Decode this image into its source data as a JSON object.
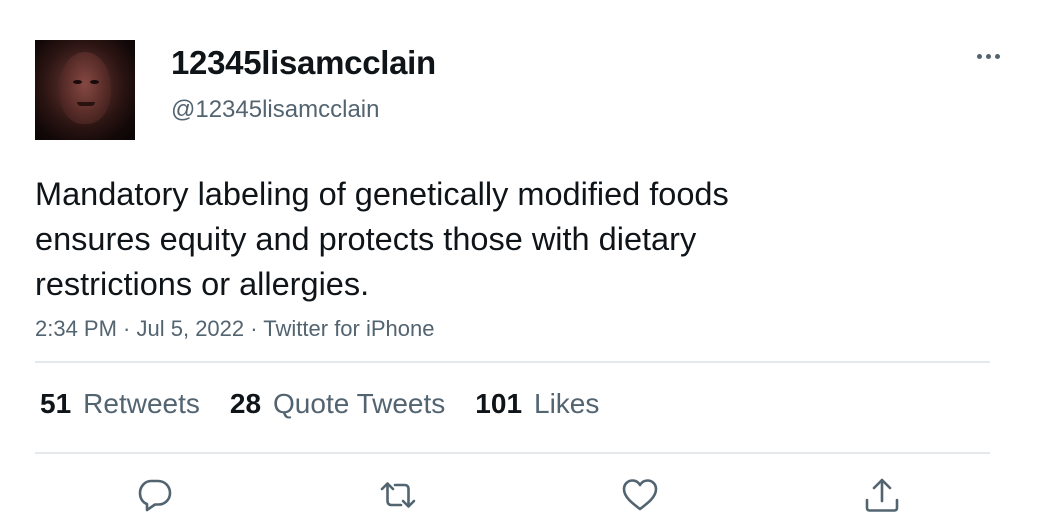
{
  "user": {
    "display_name": "12345lisamcclain",
    "handle": "@12345lisamcclain"
  },
  "tweet": {
    "text": "Mandatory labeling of genetically modified foods ensures equity and protects those with dietary restrictions or allergies.",
    "time": "2:34 PM",
    "separator1": " · ",
    "date": "Jul 5, 2022",
    "separator2": " · ",
    "source": "Twitter for iPhone"
  },
  "stats": {
    "retweets_count": "51",
    "retweets_label": "Retweets",
    "quotes_count": "28",
    "quotes_label": "Quote Tweets",
    "likes_count": "101",
    "likes_label": "Likes"
  },
  "colors": {
    "text": "#0f1419",
    "secondary": "#536471",
    "divider": "#e6e9eb"
  },
  "icons": [
    "more-icon",
    "reply-icon",
    "retweet-icon",
    "like-icon",
    "share-icon"
  ]
}
